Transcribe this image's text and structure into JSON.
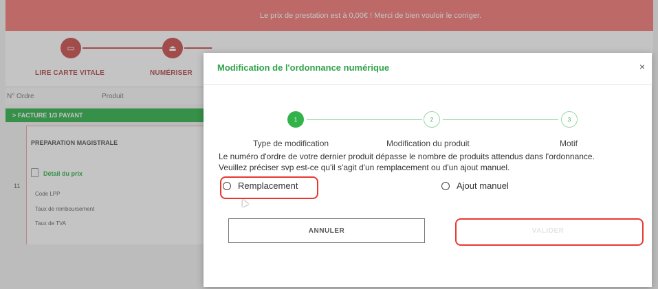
{
  "alert": {
    "message": "Le prix de prestation est à 0,00€ ! Merci de bien vouloir le corriger."
  },
  "steps": [
    {
      "label": "LIRE CARTE VITALE",
      "icon": "card-icon"
    },
    {
      "label": "NUMÉRISER",
      "icon": "scan-icon"
    }
  ],
  "table": {
    "headers": [
      "N° Ordre",
      "Produit"
    ],
    "group_label": "> FACTURE 1/3 PAYANT",
    "item_label": "PREPARATION MAGISTRALE",
    "row_number": "11",
    "detail": {
      "title": "Détail du prix",
      "rows": [
        "Code LPP",
        "Taux de remboursement",
        "Taux de TVA"
      ]
    }
  },
  "modal": {
    "title": "Modification de l'ordonnance numérique",
    "close": "×",
    "wizard": [
      {
        "num": "1",
        "label": "Type de modification",
        "active": true
      },
      {
        "num": "2",
        "label": "Modification du produit",
        "active": false
      },
      {
        "num": "3",
        "label": "Motif",
        "active": false
      }
    ],
    "message_line1": "Le numéro d'ordre de votre dernier produit dépasse le nombre de produits attendus dans l'ordonnance.",
    "message_line2": "Veuillez préciser svp est-ce qu'il s'agit d'un remplacement ou d'un ajout manuel.",
    "options": {
      "replacement": "Remplacement",
      "manual_add": "Ajout manuel"
    },
    "buttons": {
      "cancel": "ANNULER",
      "validate": "VALIDER"
    }
  },
  "colors": {
    "alert_bg": "#f47a78",
    "brand_green": "#2fb34a",
    "step_red": "#cc4d4d",
    "highlight_red": "#e8382e"
  }
}
